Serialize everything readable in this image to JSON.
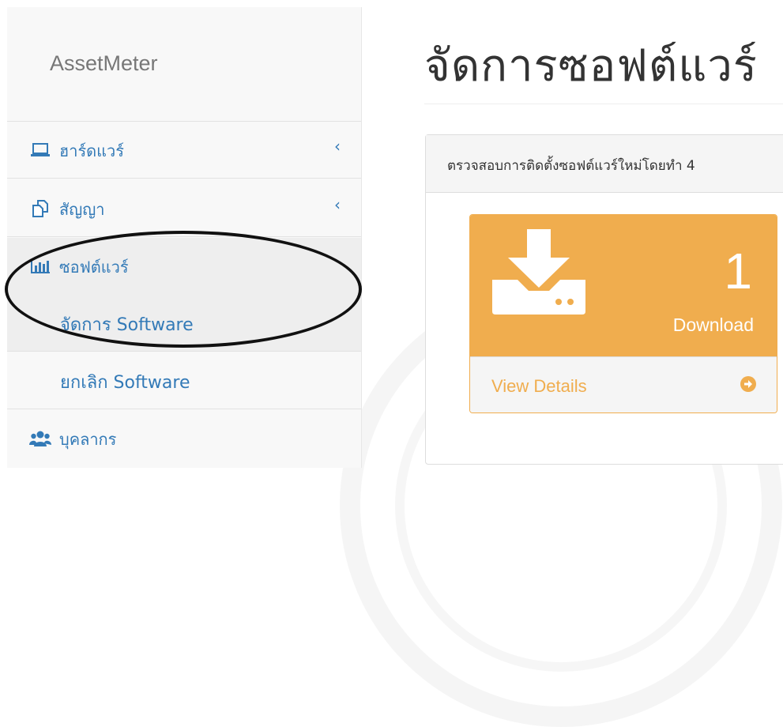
{
  "brand": {
    "name": "AssetMeter"
  },
  "sidebar": {
    "items": [
      {
        "label": "ฮาร์ดแวร์",
        "icon": "laptop-icon",
        "chevron": "‹"
      },
      {
        "label": "สัญญา",
        "icon": "copy-icon",
        "chevron": "‹"
      },
      {
        "label": "ซอฟต์แวร์",
        "icon": "bar-chart-icon"
      },
      {
        "label": "บุคลากร",
        "icon": "users-icon"
      }
    ],
    "software_submenu": [
      {
        "label": "จัดการ Software"
      },
      {
        "label": "ยกเลิก Software"
      }
    ]
  },
  "main": {
    "page_title": "จัดการซอฟต์แวร์",
    "panel_heading": "ตรวจสอบการติดตั้งซอฟต์แวร์ใหม่โดยทำ 4",
    "card": {
      "count": "1",
      "caption": "Download",
      "link_label": "View Details",
      "icon": "download-icon",
      "arrow_icon": "arrow-circle-right-icon"
    }
  },
  "colors": {
    "link": "#337ab7",
    "warning": "#f0ad4e",
    "sidebar_bg": "#f8f8f8",
    "active_bg": "#eeeeee"
  }
}
